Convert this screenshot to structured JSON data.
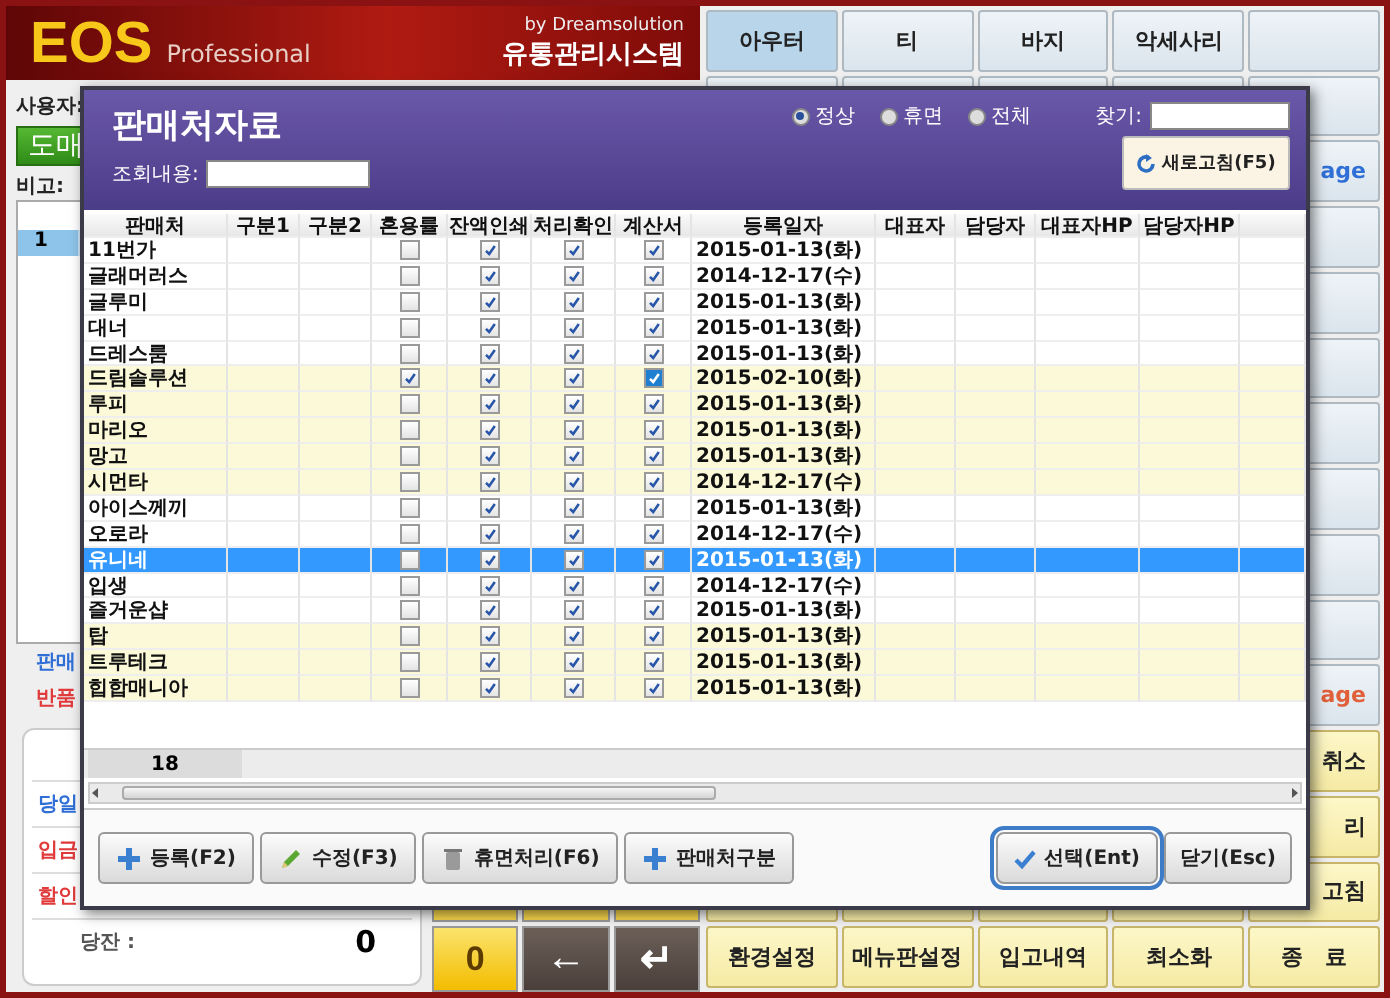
{
  "app": {
    "logo": "EOS",
    "edition": "Professional",
    "vendor": "by Dreamsolution",
    "system_name": "유통관리시스템"
  },
  "left_panel": {
    "user_label": "사용자:",
    "mode_button": "도매",
    "note_label": "비고:",
    "list_rows": [
      {
        "number": "1",
        "selected": true
      }
    ],
    "sale_label": "판매",
    "return_label": "반품",
    "summary": [
      {
        "label": "당일",
        "color": "#2f6fd6"
      },
      {
        "label": "입금",
        "color": "#e03a3a"
      },
      {
        "label": "할인",
        "color": "#e03a3a"
      }
    ],
    "balance": {
      "label": "당잔 :",
      "value": "0"
    },
    "keypad": [
      {
        "kind": "digit",
        "label": "0"
      },
      {
        "kind": "arrow",
        "label": "←"
      },
      {
        "kind": "arrow",
        "label": "↵"
      }
    ]
  },
  "menu": {
    "categories": [
      {
        "label": "아우터",
        "selected": true
      },
      {
        "label": "티",
        "selected": false
      },
      {
        "label": "바지",
        "selected": false
      },
      {
        "label": "악세사리",
        "selected": false
      }
    ],
    "side": [
      {
        "kind": "blank"
      },
      {
        "kind": "blank"
      },
      {
        "kind": "link",
        "label": "age",
        "color": "#2f6fd6"
      },
      {
        "kind": "blank"
      },
      {
        "kind": "blank"
      },
      {
        "kind": "blank"
      },
      {
        "kind": "blank"
      },
      {
        "kind": "blank"
      },
      {
        "kind": "blank"
      },
      {
        "kind": "blank"
      },
      {
        "kind": "link",
        "label": "age",
        "color": "#e0603a"
      },
      {
        "kind": "key",
        "label": "취소"
      },
      {
        "kind": "key",
        "label": "리"
      },
      {
        "kind": "key",
        "label": "고침"
      }
    ],
    "bottom": [
      "환경설정",
      "메뉴판설정",
      "입고내역",
      "최소화",
      "종　료"
    ]
  },
  "dialog": {
    "title": "판매처자료",
    "filters": [
      {
        "label": "정상",
        "selected": true
      },
      {
        "label": "휴면",
        "selected": false
      },
      {
        "label": "전체",
        "selected": false
      }
    ],
    "find_label": "찾기:",
    "query_label": "조회내용:",
    "refresh_button": "새로고침(F5)",
    "columns": [
      "판매처",
      "구분1",
      "구분2",
      "혼용률",
      "잔액인쇄",
      "처리확인",
      "계산서",
      "등록일자",
      "대표자",
      "담당자",
      "대표자HP",
      "담당자HP"
    ],
    "rows": [
      {
        "name": "11번가",
        "date": "2015-01-13(화)",
        "highlighted": false,
        "selected": false,
        "mixed_rate": false,
        "balance_print": true,
        "confirmed": true,
        "invoice": true,
        "invoice_focused": false
      },
      {
        "name": "글래머러스",
        "date": "2014-12-17(수)",
        "highlighted": false,
        "selected": false,
        "mixed_rate": false,
        "balance_print": true,
        "confirmed": true,
        "invoice": true,
        "invoice_focused": false
      },
      {
        "name": "글루미",
        "date": "2015-01-13(화)",
        "highlighted": false,
        "selected": false,
        "mixed_rate": false,
        "balance_print": true,
        "confirmed": true,
        "invoice": true,
        "invoice_focused": false
      },
      {
        "name": "대너",
        "date": "2015-01-13(화)",
        "highlighted": false,
        "selected": false,
        "mixed_rate": false,
        "balance_print": true,
        "confirmed": true,
        "invoice": true,
        "invoice_focused": false
      },
      {
        "name": "드레스룸",
        "date": "2015-01-13(화)",
        "highlighted": false,
        "selected": false,
        "mixed_rate": false,
        "balance_print": true,
        "confirmed": true,
        "invoice": true,
        "invoice_focused": false
      },
      {
        "name": "드림솔루션",
        "date": "2015-02-10(화)",
        "highlighted": true,
        "selected": false,
        "mixed_rate": true,
        "balance_print": true,
        "confirmed": true,
        "invoice": true,
        "invoice_focused": true
      },
      {
        "name": "루피",
        "date": "2015-01-13(화)",
        "highlighted": true,
        "selected": false,
        "mixed_rate": false,
        "balance_print": true,
        "confirmed": true,
        "invoice": true,
        "invoice_focused": false
      },
      {
        "name": "마리오",
        "date": "2015-01-13(화)",
        "highlighted": true,
        "selected": false,
        "mixed_rate": false,
        "balance_print": true,
        "confirmed": true,
        "invoice": true,
        "invoice_focused": false
      },
      {
        "name": "망고",
        "date": "2015-01-13(화)",
        "highlighted": true,
        "selected": false,
        "mixed_rate": false,
        "balance_print": true,
        "confirmed": true,
        "invoice": true,
        "invoice_focused": false
      },
      {
        "name": "시먼타",
        "date": "2014-12-17(수)",
        "highlighted": true,
        "selected": false,
        "mixed_rate": false,
        "balance_print": true,
        "confirmed": true,
        "invoice": true,
        "invoice_focused": false
      },
      {
        "name": "아이스께끼",
        "date": "2015-01-13(화)",
        "highlighted": false,
        "selected": false,
        "mixed_rate": false,
        "balance_print": true,
        "confirmed": true,
        "invoice": true,
        "invoice_focused": false
      },
      {
        "name": "오로라",
        "date": "2014-12-17(수)",
        "highlighted": false,
        "selected": false,
        "mixed_rate": false,
        "balance_print": true,
        "confirmed": true,
        "invoice": true,
        "invoice_focused": false
      },
      {
        "name": "유니네",
        "date": "2015-01-13(화)",
        "selected": true,
        "mixed_rate": false,
        "balance_print": true,
        "confirmed": true,
        "invoice": true,
        "invoice_focused": false
      },
      {
        "name": "입생",
        "date": "2014-12-17(수)",
        "highlighted": false,
        "selected": false,
        "mixed_rate": false,
        "balance_print": true,
        "confirmed": true,
        "invoice": true,
        "invoice_focused": false
      },
      {
        "name": "즐거운샵",
        "date": "2015-01-13(화)",
        "highlighted": false,
        "selected": false,
        "mixed_rate": false,
        "balance_print": true,
        "confirmed": true,
        "invoice": true,
        "invoice_focused": false
      },
      {
        "name": "탑",
        "date": "2015-01-13(화)",
        "highlighted": true,
        "selected": false,
        "mixed_rate": false,
        "balance_print": true,
        "confirmed": true,
        "invoice": true,
        "invoice_focused": false
      },
      {
        "name": "트루테크",
        "date": "2015-01-13(화)",
        "highlighted": true,
        "selected": false,
        "mixed_rate": false,
        "balance_print": true,
        "confirmed": true,
        "invoice": true,
        "invoice_focused": false
      },
      {
        "name": "힙합매니아",
        "date": "2015-01-13(화)",
        "highlighted": true,
        "selected": false,
        "mixed_rate": false,
        "balance_print": true,
        "confirmed": true,
        "invoice": true,
        "invoice_focused": false
      }
    ],
    "row_count": "18",
    "actions": [
      {
        "kind": "add",
        "label": "등록(F2)"
      },
      {
        "kind": "edit",
        "label": "수정(F3)"
      },
      {
        "kind": "delete",
        "label": "휴면처리(F6)"
      },
      {
        "kind": "add",
        "label": "판매처구분"
      }
    ],
    "confirm": {
      "label": "선택(Ent)",
      "focused": true
    },
    "close_button": "닫기(Esc)"
  }
}
